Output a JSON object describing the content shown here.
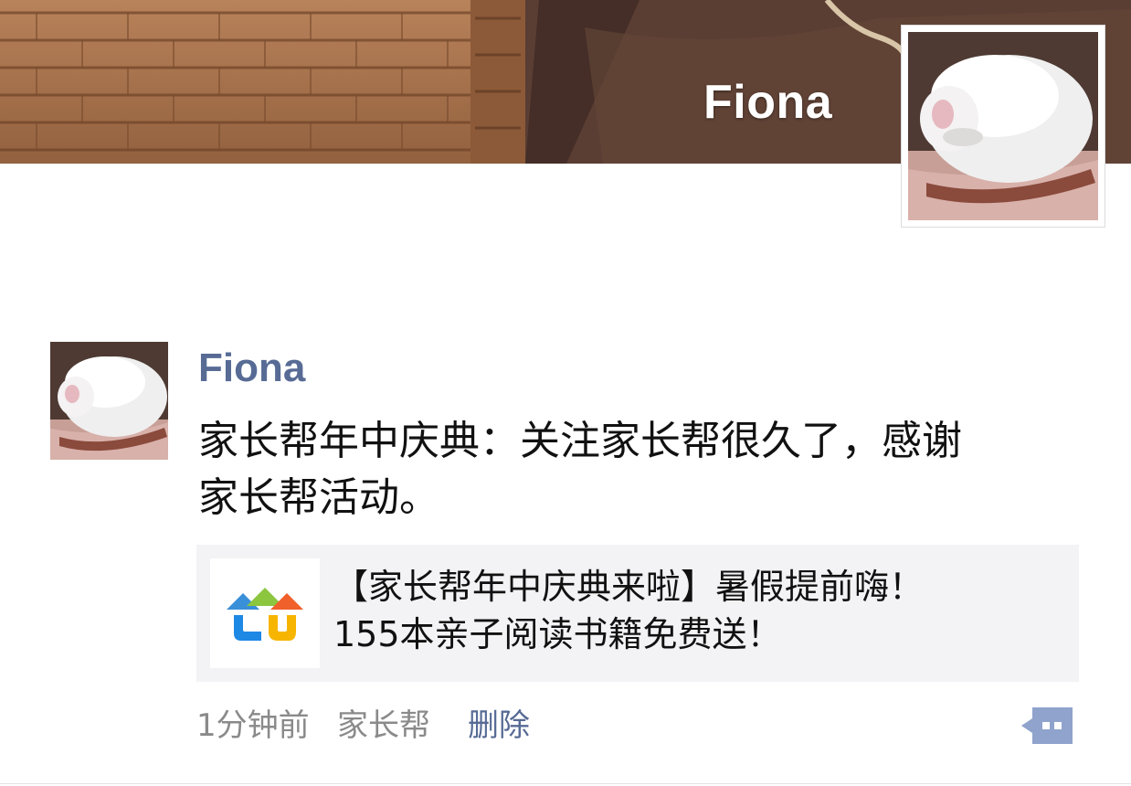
{
  "profile": {
    "name": "Fiona"
  },
  "post": {
    "author": "Fiona",
    "text_lines": [
      "家长帮年中庆典：关注家长帮很久了，感谢",
      "家长帮活动。"
    ],
    "link": {
      "title_lines": [
        "【家长帮年中庆典来啦】暑假提前嗨！",
        "155本亲子阅读书籍免费送！"
      ],
      "thumb_icon": "house-logo-icon"
    },
    "time": "1分钟前",
    "source": "家长帮",
    "delete_label": "删除",
    "comment_icon": "comment-icon"
  },
  "colors": {
    "link_blue": "#576b95",
    "meta_gray": "#8a8a8a",
    "card_bg": "#f3f3f5"
  }
}
